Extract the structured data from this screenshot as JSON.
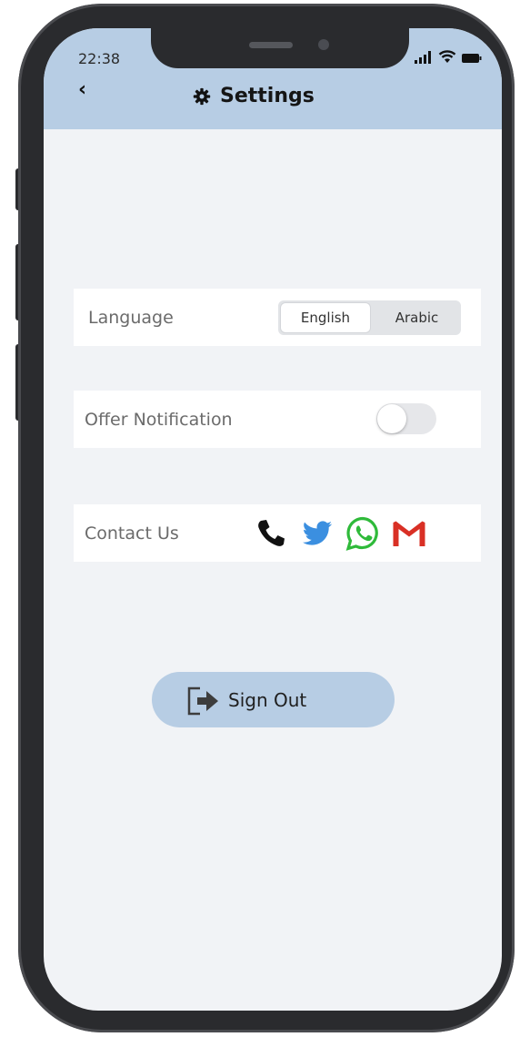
{
  "status_bar": {
    "time": "22:38"
  },
  "header": {
    "back_icon": "chevron-left-icon",
    "title": "Settings",
    "title_icon": "gear-icon",
    "background": "#b7cde4"
  },
  "language": {
    "label": "Language",
    "options": [
      "English",
      "Arabic"
    ],
    "selected": "English"
  },
  "offer_notification": {
    "label": "Offer Notification",
    "enabled": false
  },
  "contact": {
    "label": "Contact Us",
    "icons": [
      "phone-icon",
      "twitter-icon",
      "whatsapp-icon",
      "gmail-icon"
    ],
    "colors": {
      "twitter": "#3b8fe0",
      "whatsapp": "#2fba3a",
      "gmail": "#d93025"
    }
  },
  "sign_out": {
    "label": "Sign Out",
    "icon": "sign-out-icon"
  }
}
